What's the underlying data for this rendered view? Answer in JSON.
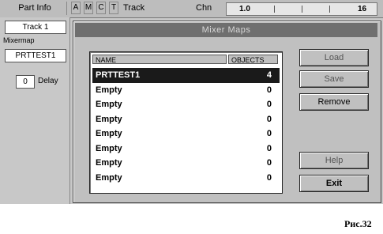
{
  "topbar": {
    "part_info": "Part Info",
    "flags": [
      "A",
      "M",
      "C",
      "T"
    ],
    "track": "Track",
    "chn": "Chn",
    "ruler_marks": [
      "1.0",
      "16"
    ]
  },
  "left_panel": {
    "track_value": "Track 1",
    "mixermap_label": "Mixermap",
    "mixermap_value": "PRTTEST1",
    "delay_value": "0",
    "delay_label": "Delay"
  },
  "dialog": {
    "title": "Mixer Maps",
    "columns": [
      "NAME",
      "OBJECTS"
    ],
    "rows": [
      {
        "name": "PRTTEST1",
        "objects": "4"
      },
      {
        "name": "Empty",
        "objects": "0"
      },
      {
        "name": "Empty",
        "objects": "0"
      },
      {
        "name": "Empty",
        "objects": "0"
      },
      {
        "name": "Empty",
        "objects": "0"
      },
      {
        "name": "Empty",
        "objects": "0"
      },
      {
        "name": "Empty",
        "objects": "0"
      },
      {
        "name": "Empty",
        "objects": "0"
      }
    ],
    "buttons": {
      "load": "Load",
      "save": "Save",
      "remove": "Remove",
      "help": "Help",
      "exit": "Exit"
    }
  },
  "caption": "Рис.32"
}
